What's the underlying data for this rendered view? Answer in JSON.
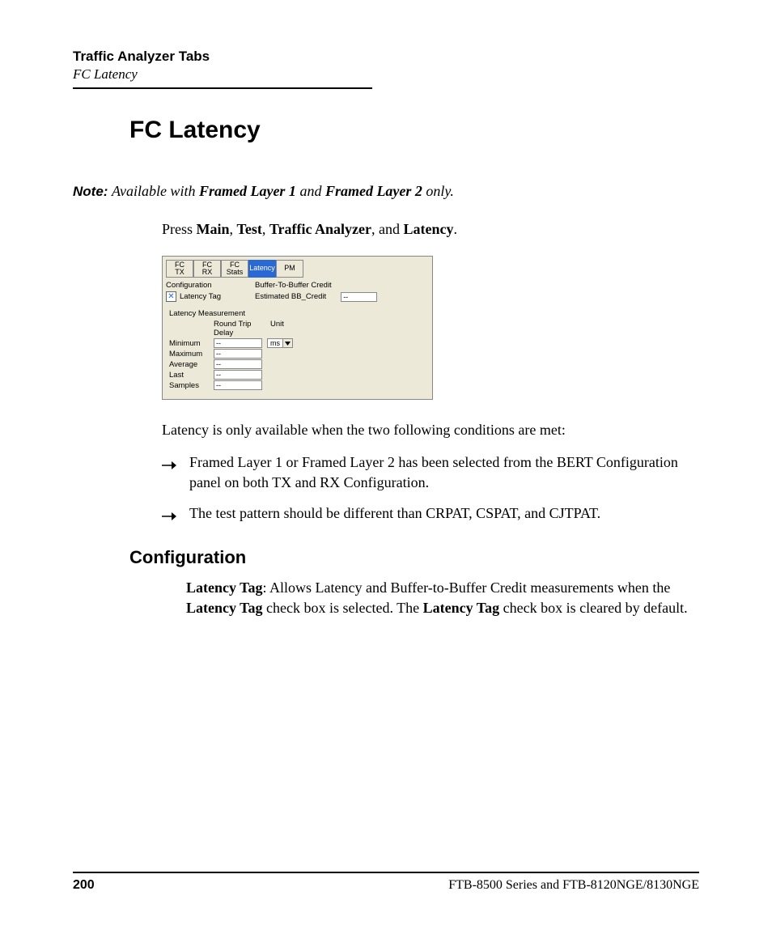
{
  "header": {
    "chapter": "Traffic Analyzer Tabs",
    "section": "FC Latency"
  },
  "h1": "FC Latency",
  "note": {
    "label": "Note:",
    "pre": "Available with ",
    "b1": "Framed Layer 1",
    "mid": " and ",
    "b2": "Framed Layer 2",
    "post": " only."
  },
  "press": {
    "pre": "Press ",
    "b1": "Main",
    "s1": ", ",
    "b2": "Test",
    "s2": ", ",
    "b3": "Traffic Analyzer",
    "s3": ", and ",
    "b4": "Latency",
    "post": "."
  },
  "ui": {
    "tabs": {
      "t1a": "FC",
      "t1b": "TX",
      "t2a": "FC",
      "t2b": "RX",
      "t3a": "FC",
      "t3b": "Stats",
      "t4": "Latency",
      "t5": "PM"
    },
    "config_heading": "Configuration",
    "latency_tag_label": "Latency Tag",
    "latency_tag_checked_glyph": "✕",
    "buffer_heading": "Buffer-To-Buffer Credit",
    "estimated_label": "Estimated BB_Credit",
    "estimated_value": "--",
    "measurement_heading": "Latency Measurement",
    "col_rtd": "Round Trip Delay",
    "col_unit": "Unit",
    "unit_value": "ms",
    "rows": {
      "minimum": "Minimum",
      "maximum": "Maximum",
      "average": "Average",
      "last": "Last",
      "samples": "Samples"
    },
    "value_placeholder": "--"
  },
  "after_ui": "Latency is only available when the two following conditions are met:",
  "bullets": {
    "b1": "Framed Layer 1 or Framed Layer 2 has been selected from the BERT Configuration panel on both TX and RX Configuration.",
    "b2": "The test pattern should be different than CRPAT, CSPAT, and CJTPAT."
  },
  "h2": "Configuration",
  "config_body": {
    "b1": "Latency Tag",
    "t1": ": Allows Latency and Buffer-to-Buffer Credit measurements when the ",
    "b2": "Latency Tag",
    "t2": " check box is selected. The ",
    "b3": "Latency Tag",
    "t3": " check box is cleared by default."
  },
  "footer": {
    "page": "200",
    "doc": "FTB-8500 Series and FTB-8120NGE/8130NGE"
  }
}
